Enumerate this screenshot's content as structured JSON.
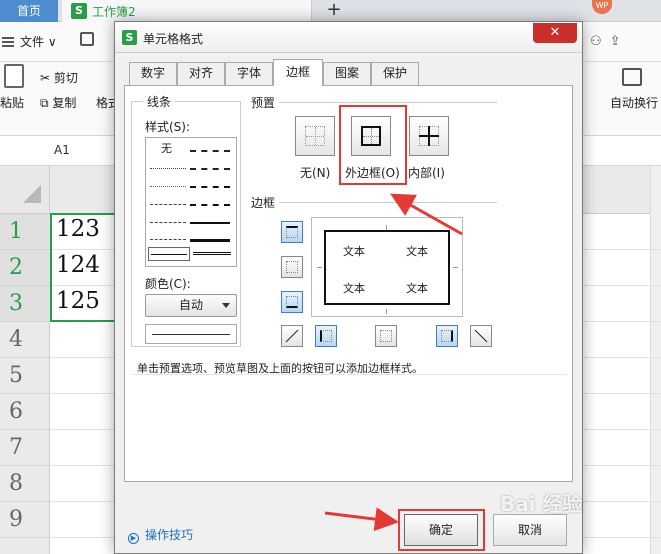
{
  "app": {
    "tabs": {
      "home": "首页",
      "workbook": "工作簿2",
      "new_tab": "+"
    },
    "avatar": "WP",
    "menu": {
      "file": "文件"
    },
    "ribbon": {
      "paste": "粘贴",
      "cut": "剪切",
      "copy": "复制",
      "format_painter": "格式",
      "wrap_text": "自动换行"
    },
    "name_box": "A1"
  },
  "sheet": {
    "rows": [
      "1",
      "2",
      "3",
      "4",
      "5",
      "6",
      "7",
      "8",
      "9"
    ],
    "values": [
      "123",
      "124",
      "125"
    ],
    "selected_rows": 3
  },
  "dialog": {
    "title": "单元格格式",
    "close": "✕",
    "tabs": [
      {
        "label": "数字"
      },
      {
        "label": "对齐"
      },
      {
        "label": "字体"
      },
      {
        "label": "边框",
        "active": true
      },
      {
        "label": "图案"
      },
      {
        "label": "保护"
      }
    ],
    "line": {
      "group_label": "线条",
      "style_label": "样式(S):",
      "none_label": "无",
      "color_label": "颜色(C):",
      "color_value": "自动"
    },
    "presets": {
      "label": "预置",
      "none": "无(N)",
      "outline": "外边框(O)",
      "inside": "内部(I)"
    },
    "border": {
      "label": "边框",
      "preview_text": [
        "文本",
        "文本",
        "文本",
        "文本"
      ]
    },
    "hint": "单击预置选项、预览草图及上面的按钮可以添加边框样式。",
    "tips": "操作技巧",
    "ok": "确定",
    "cancel": "取消"
  },
  "watermark": "Bai 经验",
  "colors": {
    "accent_green": "#2a9d48",
    "annotation_red": "#e53935",
    "selected_blue": "#3d7cc9"
  }
}
